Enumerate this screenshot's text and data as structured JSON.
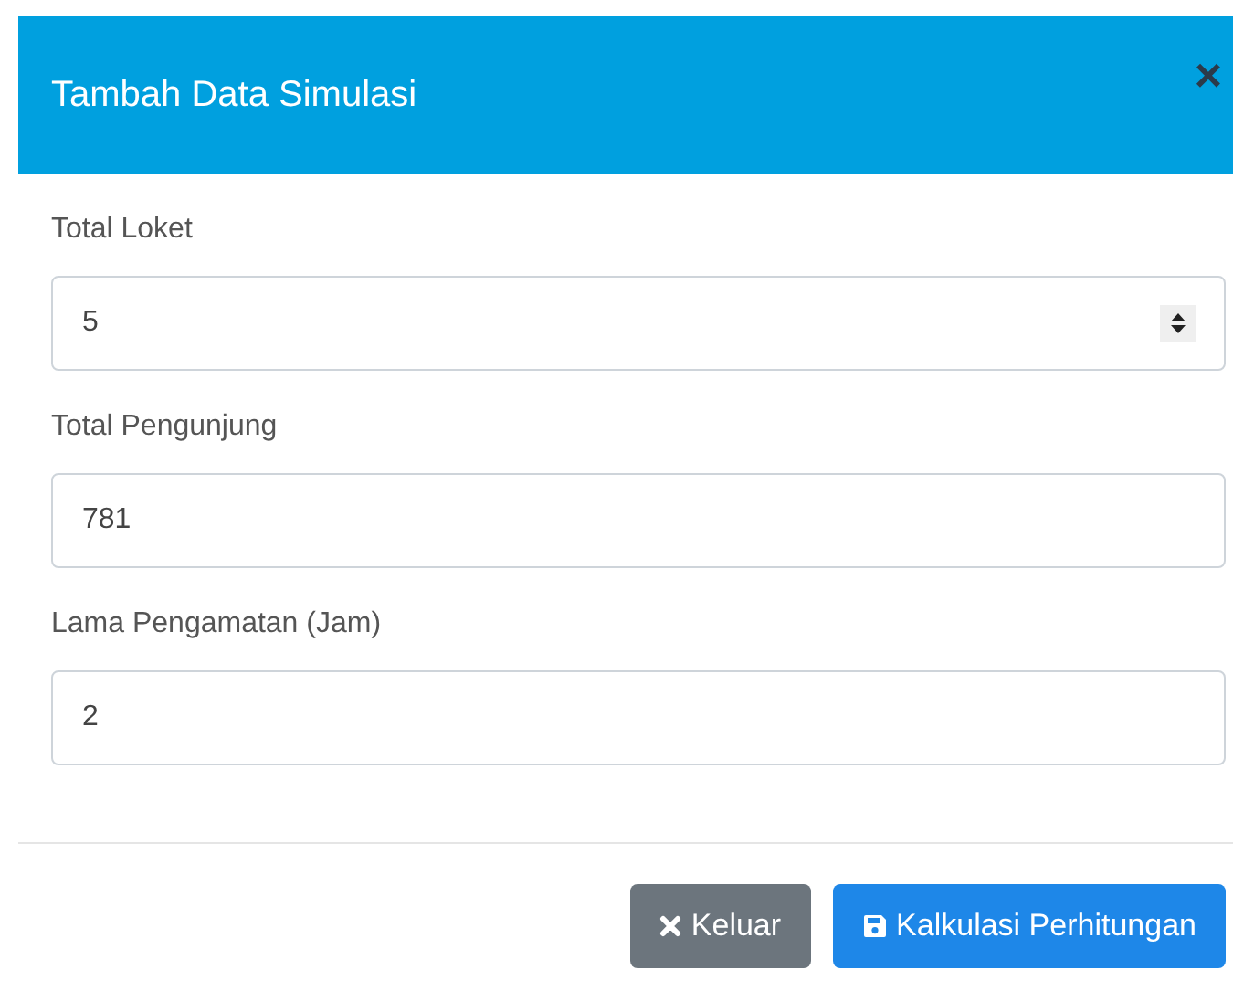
{
  "modal": {
    "title": "Tambah Data Simulasi",
    "close": "×"
  },
  "fields": [
    {
      "label": "Total Loket",
      "value": "5",
      "kind": "number"
    },
    {
      "label": "Total Pengunjung",
      "value": "781",
      "kind": "text"
    },
    {
      "label": "Lama Pengamatan (Jam)",
      "value": "2",
      "kind": "text"
    }
  ],
  "buttons": [
    {
      "label": "Keluar",
      "kind": "close"
    },
    {
      "label": "Kalkulasi Perhitungan",
      "kind": "save"
    }
  ]
}
